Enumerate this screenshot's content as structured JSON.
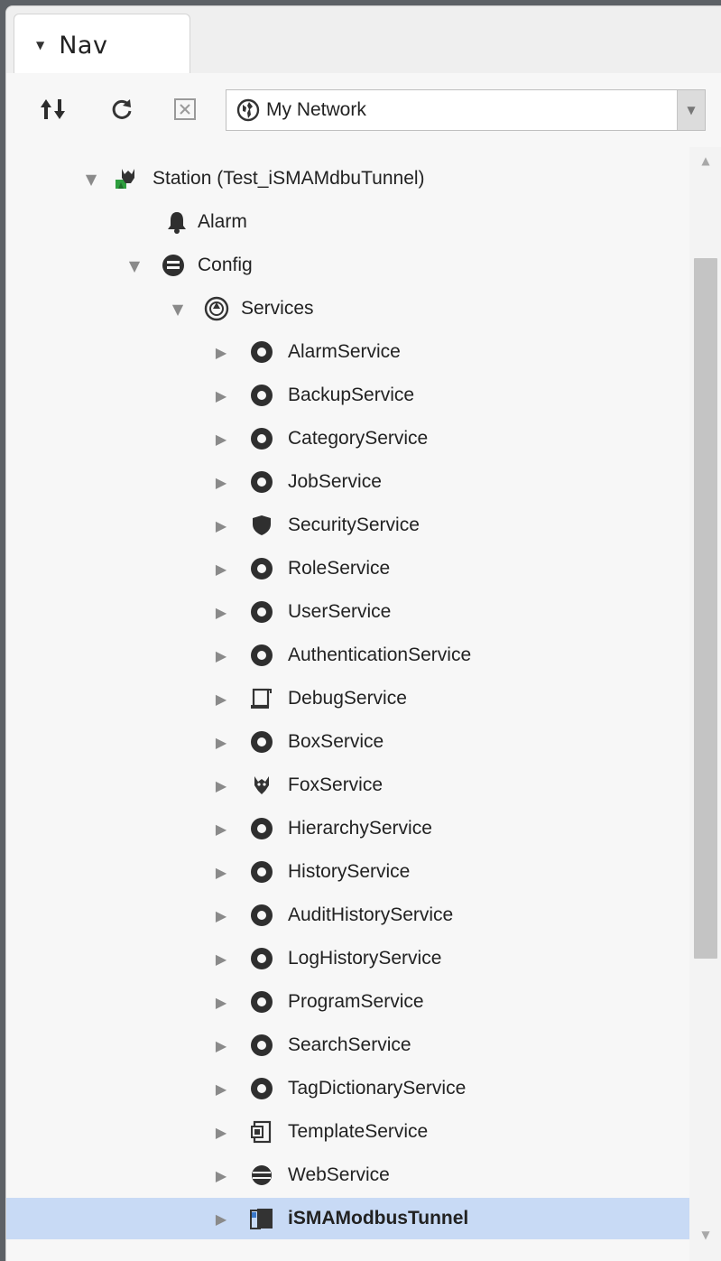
{
  "tab": {
    "title": "Nav",
    "caret_icon": "caret-down-icon"
  },
  "toolbar": {
    "buttons": [
      {
        "name": "sort-button",
        "icon": "sort-arrows-icon"
      },
      {
        "name": "refresh-button",
        "icon": "refresh-icon"
      },
      {
        "name": "close-button",
        "icon": "close-box-icon"
      }
    ],
    "location": {
      "icon": "globe-icon",
      "value": "My Network"
    }
  },
  "tree": {
    "station": {
      "label": "Station (Test_iSMAMdbuTunnel)",
      "icon": "station-icon",
      "expanded": true
    },
    "alarm": {
      "label": "Alarm",
      "icon": "bell-icon"
    },
    "config": {
      "label": "Config",
      "icon": "database-icon",
      "expanded": true
    },
    "services": {
      "label": "Services",
      "icon": "services-icon",
      "expanded": true
    },
    "service_items": [
      {
        "label": "AlarmService",
        "icon": "alarm-service-icon"
      },
      {
        "label": "BackupService",
        "icon": "backup-service-icon"
      },
      {
        "label": "CategoryService",
        "icon": "category-service-icon"
      },
      {
        "label": "JobService",
        "icon": "job-service-icon"
      },
      {
        "label": "SecurityService",
        "icon": "shield-icon"
      },
      {
        "label": "RoleService",
        "icon": "role-service-icon"
      },
      {
        "label": "UserService",
        "icon": "user-service-icon"
      },
      {
        "label": "AuthenticationService",
        "icon": "lock-icon"
      },
      {
        "label": "DebugService",
        "icon": "debug-service-icon"
      },
      {
        "label": "BoxService",
        "icon": "box-service-icon"
      },
      {
        "label": "FoxService",
        "icon": "fox-service-icon"
      },
      {
        "label": "HierarchyService",
        "icon": "hierarchy-service-icon"
      },
      {
        "label": "HistoryService",
        "icon": "history-service-icon"
      },
      {
        "label": "AuditHistoryService",
        "icon": "audit-history-service-icon"
      },
      {
        "label": "LogHistoryService",
        "icon": "log-history-service-icon"
      },
      {
        "label": "ProgramService",
        "icon": "program-service-icon"
      },
      {
        "label": "SearchService",
        "icon": "search-service-icon"
      },
      {
        "label": "TagDictionaryService",
        "icon": "tag-dictionary-service-icon"
      },
      {
        "label": "TemplateService",
        "icon": "template-service-icon"
      },
      {
        "label": "WebService",
        "icon": "web-service-icon"
      },
      {
        "label": "iSMAModbusTunnel",
        "icon": "modbus-tunnel-icon",
        "selected": true
      }
    ]
  },
  "colors": {
    "selection": "#c8daf5",
    "window_border": "#5d6166"
  }
}
